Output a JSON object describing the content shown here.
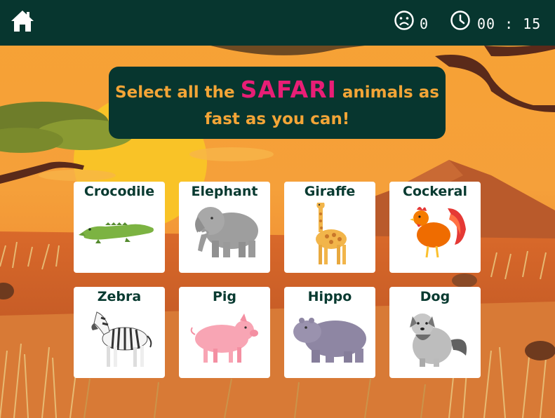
{
  "header": {
    "home_icon": "home-icon",
    "mood_icon": "sad-face-icon",
    "score": "0",
    "clock_icon": "clock-icon",
    "timer": "00 : 15"
  },
  "instruction": {
    "prefix": "Select all the ",
    "highlight": "SAFARI",
    "suffix": " animals as",
    "line2": "fast as you can!"
  },
  "colors": {
    "bar": "#07362f",
    "instruction_text": "#f3a537",
    "highlight": "#e81e76",
    "card_label": "#083a30"
  },
  "animals": [
    {
      "label": "Crocodile",
      "icon": "crocodile"
    },
    {
      "label": "Elephant",
      "icon": "elephant"
    },
    {
      "label": "Giraffe",
      "icon": "giraffe"
    },
    {
      "label": "Cockeral",
      "icon": "rooster"
    },
    {
      "label": "Zebra",
      "icon": "zebra"
    },
    {
      "label": "Pig",
      "icon": "pig"
    },
    {
      "label": "Hippo",
      "icon": "hippo"
    },
    {
      "label": "Dog",
      "icon": "dog"
    }
  ]
}
